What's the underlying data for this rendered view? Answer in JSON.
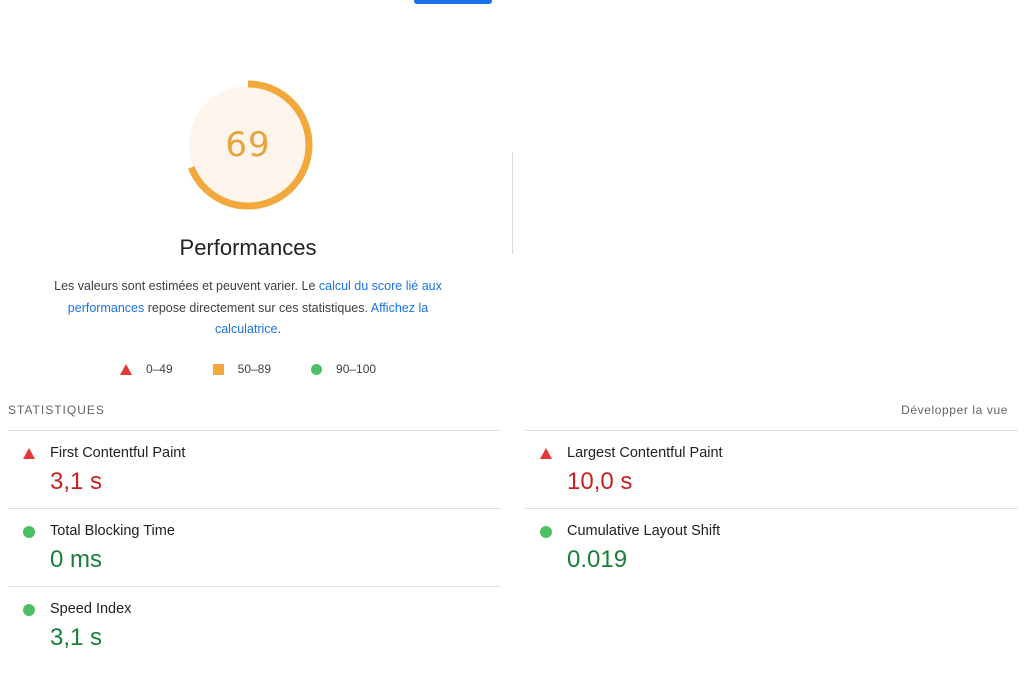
{
  "gauge": {
    "score": "69",
    "fraction": 0.69,
    "color": "#f2a83b",
    "bg": "#fdf5ec"
  },
  "performance": {
    "title": "Performances",
    "desc_text1": "Les valeurs sont estimées et peuvent varier. Le ",
    "desc_link1": "calcul du score lié aux performances",
    "desc_text2": " repose directement sur ces statistiques. ",
    "desc_link2": "Affichez la calculatrice",
    "desc_text3": "."
  },
  "legend": [
    {
      "shape": "triangle",
      "color": "#e53935",
      "label": "0–49"
    },
    {
      "shape": "square",
      "color": "#f2a83b",
      "label": "50–89"
    },
    {
      "shape": "circle",
      "color": "#4cc164",
      "label": "90–100"
    }
  ],
  "statistics": {
    "header": "STATISTIQUES",
    "expand_label": "Développer la vue",
    "left": [
      {
        "icon": "triangle",
        "label": "First Contentful Paint",
        "value": "3,1 s",
        "status": "red"
      },
      {
        "icon": "circle",
        "label": "Total Blocking Time",
        "value": "0 ms",
        "status": "green"
      },
      {
        "icon": "circle",
        "label": "Speed Index",
        "value": "3,1 s",
        "status": "green"
      }
    ],
    "right": [
      {
        "icon": "triangle",
        "label": "Largest Contentful Paint",
        "value": "10,0 s",
        "status": "red"
      },
      {
        "icon": "circle",
        "label": "Cumulative Layout Shift",
        "value": "0.019",
        "status": "green"
      }
    ]
  }
}
